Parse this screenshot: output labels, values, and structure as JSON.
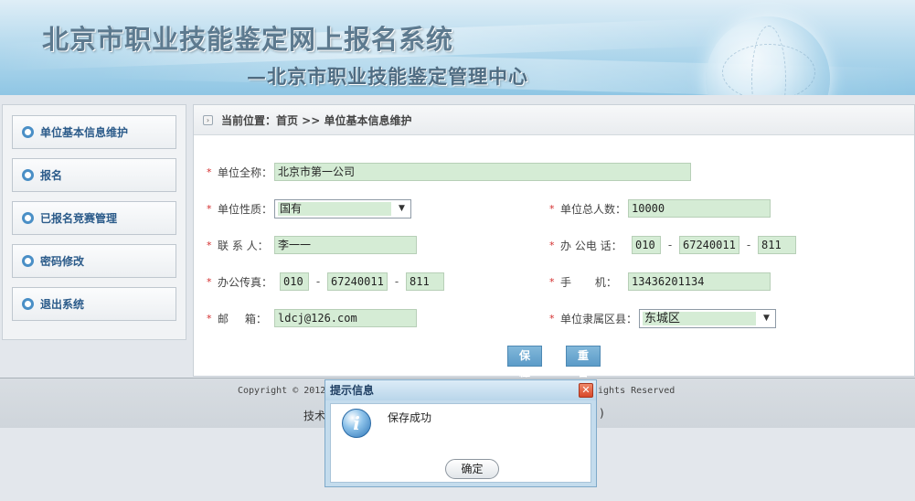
{
  "header": {
    "title": "北京市职业技能鉴定网上报名系统",
    "subtitle": "—北京市职业技能鉴定管理中心"
  },
  "sidebar": {
    "items": [
      {
        "label": "单位基本信息维护"
      },
      {
        "label": "报名"
      },
      {
        "label": "已报名竞赛管理"
      },
      {
        "label": "密码修改"
      },
      {
        "label": "退出系统"
      }
    ]
  },
  "breadcrumb": {
    "text": "当前位置：首页 >> 单位基本信息维护"
  },
  "form": {
    "required_mark": "*",
    "company_name": {
      "label": "单位全称：",
      "value": "北京市第一公司"
    },
    "company_type": {
      "label": "单位性质：",
      "value": "国有"
    },
    "total_staff": {
      "label": "单位总人数：",
      "value": "10000"
    },
    "contact": {
      "label": "联 系 人：",
      "value": "李一一"
    },
    "office_phone": {
      "label": "办 公电 话：",
      "area": "010",
      "number": "67240011",
      "ext": "811"
    },
    "office_fax": {
      "label": "办公传真：",
      "area": "010",
      "number": "67240011",
      "ext": "811"
    },
    "mobile": {
      "label": "手 机：",
      "value": "13436201134"
    },
    "email": {
      "label": "邮 箱：",
      "value": "ldcj@126.com"
    },
    "district": {
      "label": "单位隶属区县：",
      "value": "东城区"
    },
    "dash": "-",
    "save_label": "保存",
    "reset_label": "重置"
  },
  "footer": {
    "copyright_left": "Copyright © 2012",
    "copyright_right": "ights Reserved",
    "tech_left": "技术",
    "tech_right": ")"
  },
  "dialog": {
    "title": "提示信息",
    "close_glyph": "✕",
    "info_glyph": "i",
    "message": "保存成功",
    "ok_label": "确定"
  }
}
